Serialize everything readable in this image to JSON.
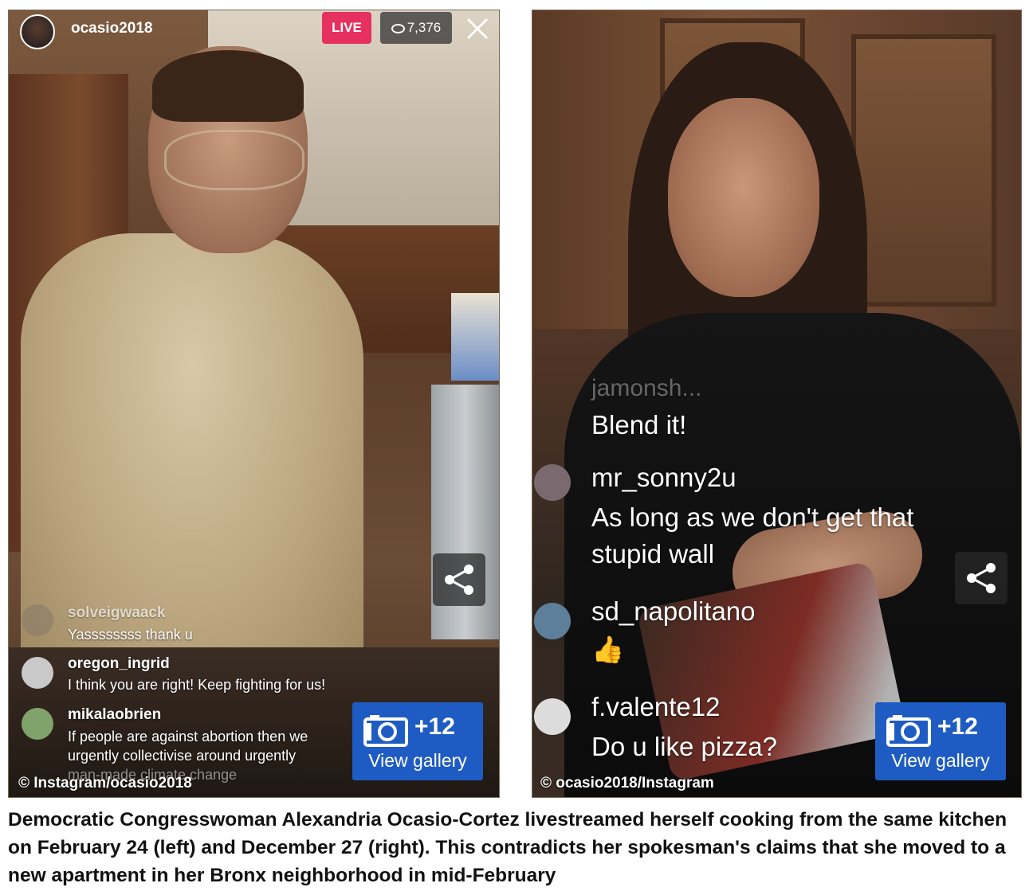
{
  "left_panel": {
    "top_bar": {
      "username": "ocasio2018",
      "live_label": "LIVE",
      "viewer_count": "7,376"
    },
    "comments": [
      {
        "user": "solveigwaack",
        "text": "Yassssssss thank u"
      },
      {
        "user": "oregon_ingrid",
        "text": "I think you are right! Keep fighting for us!"
      },
      {
        "user": "mikalaobrien",
        "text": "If people are against abortion then we",
        "text2": "urgently collectivise around urgently",
        "text3": "man-made climate change"
      }
    ],
    "credit": "© Instagram/ocasio2018",
    "gallery": {
      "count": "+12",
      "label": "View gallery"
    }
  },
  "right_panel": {
    "comments": [
      {
        "user": "jamonsh...",
        "text": "Blend it!"
      },
      {
        "user": "mr_sonny2u",
        "text": "As long as we don't get that",
        "text2": "stupid wall"
      },
      {
        "user": "sd_napolitano",
        "text": "👍"
      },
      {
        "user": "f.valente12",
        "text": "Do u like pizza?"
      }
    ],
    "credit": "© ocasio2018/Instagram",
    "gallery": {
      "count": "+12",
      "label": "View gallery"
    }
  },
  "caption": "Democratic Congresswoman Alexandria Ocasio-Cortez livestreamed herself cooking from the same kitchen on February 24 (left) and December 27 (right). This contradicts her spokesman's claims that she moved to a new apartment in her Bronx neighborhood in mid-February",
  "colors": {
    "live": "#e6305f",
    "gallery_button": "#1e5cc3"
  }
}
